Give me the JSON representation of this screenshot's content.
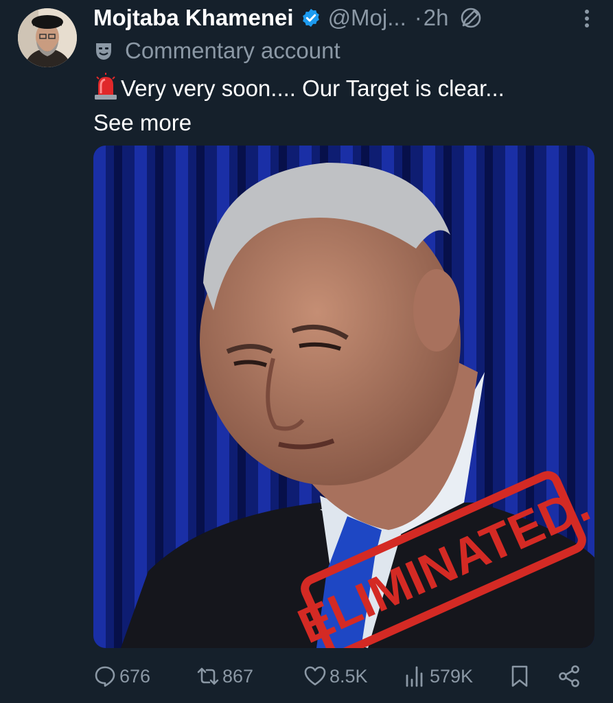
{
  "post": {
    "author_name": "Mojtaba Khamenei",
    "handle": "@Moj...",
    "separator": "·",
    "time": "2h",
    "account_label": "Commentary account",
    "text": "Very very soon.... Our Target is clear...",
    "see_more": "See more"
  },
  "media": {
    "stamp_text": "ELIMINATED."
  },
  "actions": {
    "replies": "676",
    "reposts": "867",
    "likes": "8.5K",
    "views": "579K"
  },
  "colors": {
    "background": "#15202b",
    "secondary_text": "#8b98a5",
    "verified": "#1d9bf0",
    "stamp": "#d42a24"
  }
}
